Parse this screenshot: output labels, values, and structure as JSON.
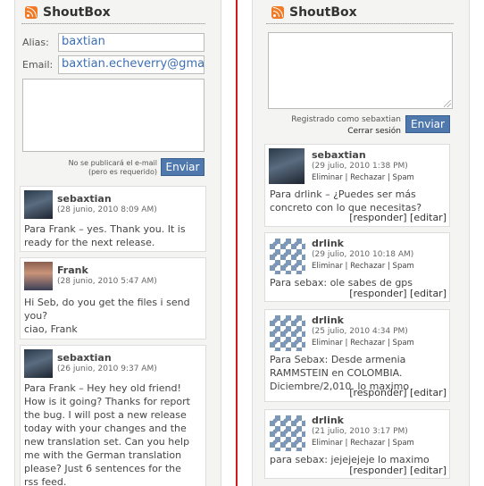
{
  "left": {
    "title": "ShoutBox",
    "alias_label": "Alias:",
    "alias_value": "baxtian",
    "email_label": "Email:",
    "email_value": "baxtian.echeverry@gma",
    "note_line1": "No se publicará el e-mail",
    "note_line2": "(pero es requerido)",
    "send_label": "Enviar",
    "shouts": [
      {
        "author": "sebaxtian",
        "date": "(28 junio, 2010 8:09 AM)",
        "message": "Para Frank – yes. Thank you. It is\nready for the next release."
      },
      {
        "author": "Frank",
        "date": "(28 junio, 2010 5:47 AM)",
        "message": "Hi Seb, do you get the files i send\nyou?\nciao, Frank"
      },
      {
        "author": "sebaxtian",
        "date": "(26 junio, 2010 9:37 AM)",
        "message": "Para Frank – Hey hey old friend!\nHow is it going? Thanks for report\nthe bug. I will post a new release\ntoday with your changes and the\nnew translation set. Can you help\nme with the German translation\nplease? Just 6 sentences for the\nrss feed."
      }
    ]
  },
  "right": {
    "title": "ShoutBox",
    "registered_as": "Registrado como sebaxtian",
    "logout": "Cerrar sesión",
    "send_label": "Enviar",
    "mod_links": "Eliminar | Rechazar | Spam",
    "reply": "[responder]",
    "edit": "[editar]",
    "shouts": [
      {
        "author": "sebaxtian",
        "date": "(29 julio, 2010 1:38 PM)",
        "message": "Para drlink – ¿Puedes ser más\nconcreto con lo que necesitas?"
      },
      {
        "author": "drlink",
        "date": "(29 julio, 2010 10:18 AM)",
        "message": "Para sebax: ole sabes de gps"
      },
      {
        "author": "drlink",
        "date": "(25 julio, 2010 4:34 PM)",
        "message": "Para Sebax: Desde armenia\nRAMMSTEIN en COLOMBIA.\nDiciembre/2,010. lo maximo"
      },
      {
        "author": "drlink",
        "date": "(21 julio, 2010 3:17 PM)",
        "message": "para sebax: jejejejeje lo maximo"
      }
    ]
  }
}
